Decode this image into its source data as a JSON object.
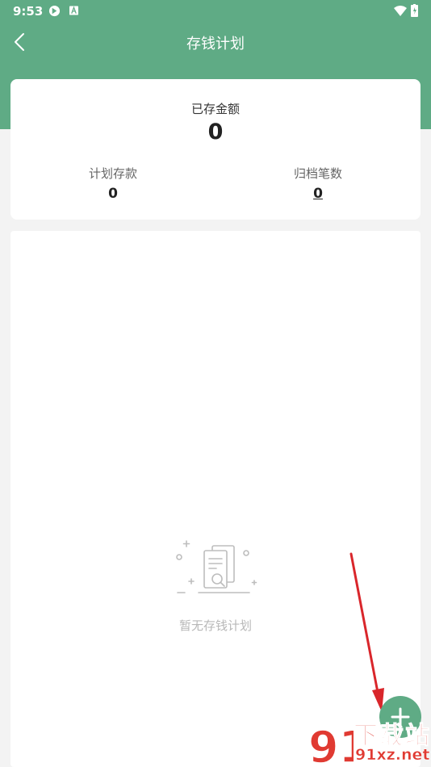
{
  "status_bar": {
    "time": "9:53"
  },
  "nav": {
    "title": "存钱计划"
  },
  "summary": {
    "saved_label": "已存金额",
    "saved_value": "0",
    "plan_label": "计划存款",
    "plan_value": "0",
    "archived_label": "归档笔数",
    "archived_value": "0"
  },
  "empty_state": {
    "text": "暂无存钱计划"
  },
  "watermark": {
    "title": "下载站",
    "url": "91xz.net",
    "logo_text": "91"
  },
  "colors": {
    "primary": "#5fab85",
    "background": "#f3f3f3",
    "annotation_arrow": "#d9262b",
    "watermark": "#e03a32"
  },
  "icons": {
    "back": "chevron-left-icon",
    "add": "plus-icon",
    "empty": "document-search-icon"
  }
}
